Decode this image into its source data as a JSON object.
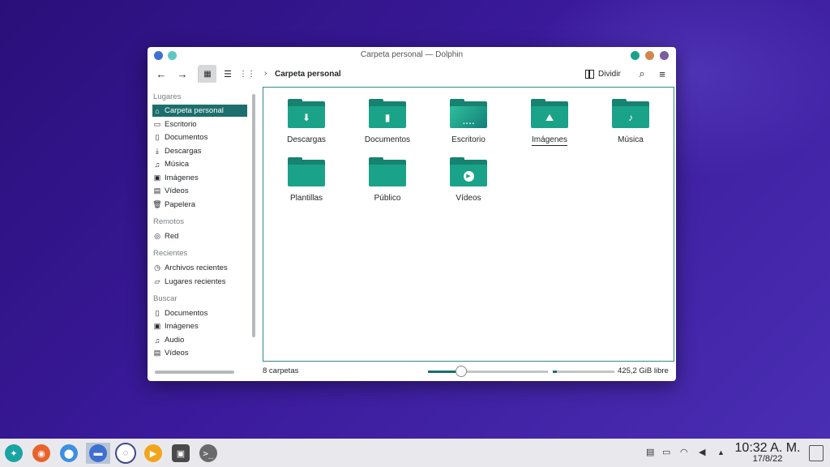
{
  "window": {
    "title": "Carpeta personal — Dolphin",
    "dot_colors": {
      "left1": "#3f6fd0",
      "left2": "#5ec7c4",
      "right1": "#1aa38a",
      "right2": "#d2864c",
      "right3": "#7b5ea0"
    }
  },
  "toolbar": {
    "back_icon": "arrow-left-icon",
    "forward_icon": "arrow-right-icon",
    "breadcrumb": "Carpeta personal",
    "split_label": "Dividir"
  },
  "sidebar": {
    "sections": [
      {
        "title": "Lugares",
        "items": [
          {
            "label": "Carpeta personal",
            "icon": "home-icon"
          },
          {
            "label": "Escritorio",
            "icon": "desktop-icon"
          },
          {
            "label": "Documentos",
            "icon": "document-icon"
          },
          {
            "label": "Descargas",
            "icon": "download-icon"
          },
          {
            "label": "Música",
            "icon": "music-icon"
          },
          {
            "label": "Imágenes",
            "icon": "image-icon"
          },
          {
            "label": "Vídeos",
            "icon": "video-icon"
          },
          {
            "label": "Papelera",
            "icon": "trash-icon"
          }
        ]
      },
      {
        "title": "Remotos",
        "items": [
          {
            "label": "Red",
            "icon": "network-icon"
          }
        ]
      },
      {
        "title": "Recientes",
        "items": [
          {
            "label": "Archivos recientes",
            "icon": "recent-files-icon"
          },
          {
            "label": "Lugares recientes",
            "icon": "recent-places-icon"
          }
        ]
      },
      {
        "title": "Buscar",
        "items": [
          {
            "label": "Documentos",
            "icon": "document-icon"
          },
          {
            "label": "Imágenes",
            "icon": "image-icon"
          },
          {
            "label": "Audio",
            "icon": "music-icon"
          },
          {
            "label": "Vídeos",
            "icon": "video-icon"
          }
        ]
      }
    ]
  },
  "folders": [
    {
      "label": "Descargas",
      "icon": "download-icon"
    },
    {
      "label": "Documentos",
      "icon": "document-icon"
    },
    {
      "label": "Escritorio",
      "icon": "desktop-icon"
    },
    {
      "label": "Imágenes",
      "icon": "image-icon"
    },
    {
      "label": "Música",
      "icon": "music-icon"
    },
    {
      "label": "Plantillas",
      "icon": "folder-icon"
    },
    {
      "label": "Público",
      "icon": "folder-icon"
    },
    {
      "label": "Vídeos",
      "icon": "play-icon"
    }
  ],
  "status": {
    "count": "8 carpetas",
    "free_space": "425,2 GiB libre",
    "zoom_level": 0.27,
    "disk_used_fraction": 0.06
  },
  "taskbar": {
    "time": "10:32 A. M.",
    "date": "17/8/22",
    "accent": "#1d6e6e"
  }
}
